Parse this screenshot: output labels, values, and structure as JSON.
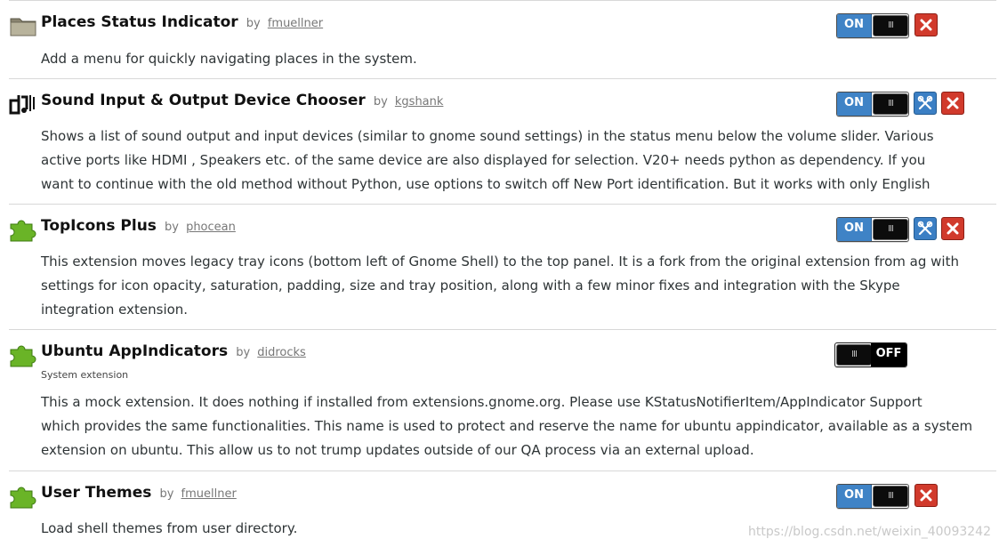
{
  "extensions": [
    {
      "icon": "folder-icon",
      "name": "Places Status Indicator",
      "by": "by",
      "creator": "fmuellner",
      "system_note": "",
      "description": [
        "Add a menu for quickly navigating places in the system."
      ],
      "state": "ON",
      "has_settings": false,
      "has_remove": true
    },
    {
      "icon": "sound-device-icon",
      "name": "Sound Input & Output Device Chooser",
      "by": "by",
      "creator": "kgshank",
      "system_note": "",
      "description": [
        "Shows a list of sound output and input devices (similar to gnome sound settings) in the status menu below the volume slider. Various",
        "active ports like HDMI , Speakers etc. of the same device are also displayed for selection. V20+ needs python as dependency. If you",
        "want to continue with the old method without Python, use options to switch off New Port identification. But it works with only English"
      ],
      "state": "ON",
      "has_settings": true,
      "has_remove": true
    },
    {
      "icon": "puzzle-piece-icon",
      "name": "TopIcons Plus",
      "by": "by",
      "creator": "phocean",
      "system_note": "",
      "description": [
        "This extension moves legacy tray icons (bottom left of Gnome Shell) to the top panel. It is a fork from the original extension from ag with",
        "settings for icon opacity, saturation, padding, size and tray position, along with a few minor fixes and integration with the Skype",
        "integration extension."
      ],
      "state": "ON",
      "has_settings": true,
      "has_remove": true
    },
    {
      "icon": "puzzle-piece-icon",
      "name": "Ubuntu AppIndicators",
      "by": "by",
      "creator": "didrocks",
      "system_note": "System extension",
      "description": [
        "This a mock extension. It does nothing if installed from extensions.gnome.org. Please use KStatusNotifierItem/AppIndicator Support",
        "which provides the same functionalities. This name is used to protect and reserve the name for ubuntu appindicator, available as a system",
        "extension on ubuntu. This allow us to not trump updates outside of our QA process via an external upload."
      ],
      "state": "OFF",
      "has_settings": false,
      "has_remove": false
    },
    {
      "icon": "puzzle-piece-icon",
      "name": "User Themes",
      "by": "by",
      "creator": "fmuellner",
      "system_note": "",
      "description": [
        "Load shell themes from user directory."
      ],
      "state": "ON",
      "has_settings": false,
      "has_remove": true
    }
  ],
  "toggle": {
    "on_label": "ON",
    "off_label": "OFF",
    "knob_label": "III"
  },
  "watermark": "https://blog.csdn.net/weixin_40093242",
  "colors": {
    "on_blue": "#3f83c6",
    "remove_red": "#d13a2c",
    "settings_blue": "#3b7fc4"
  }
}
